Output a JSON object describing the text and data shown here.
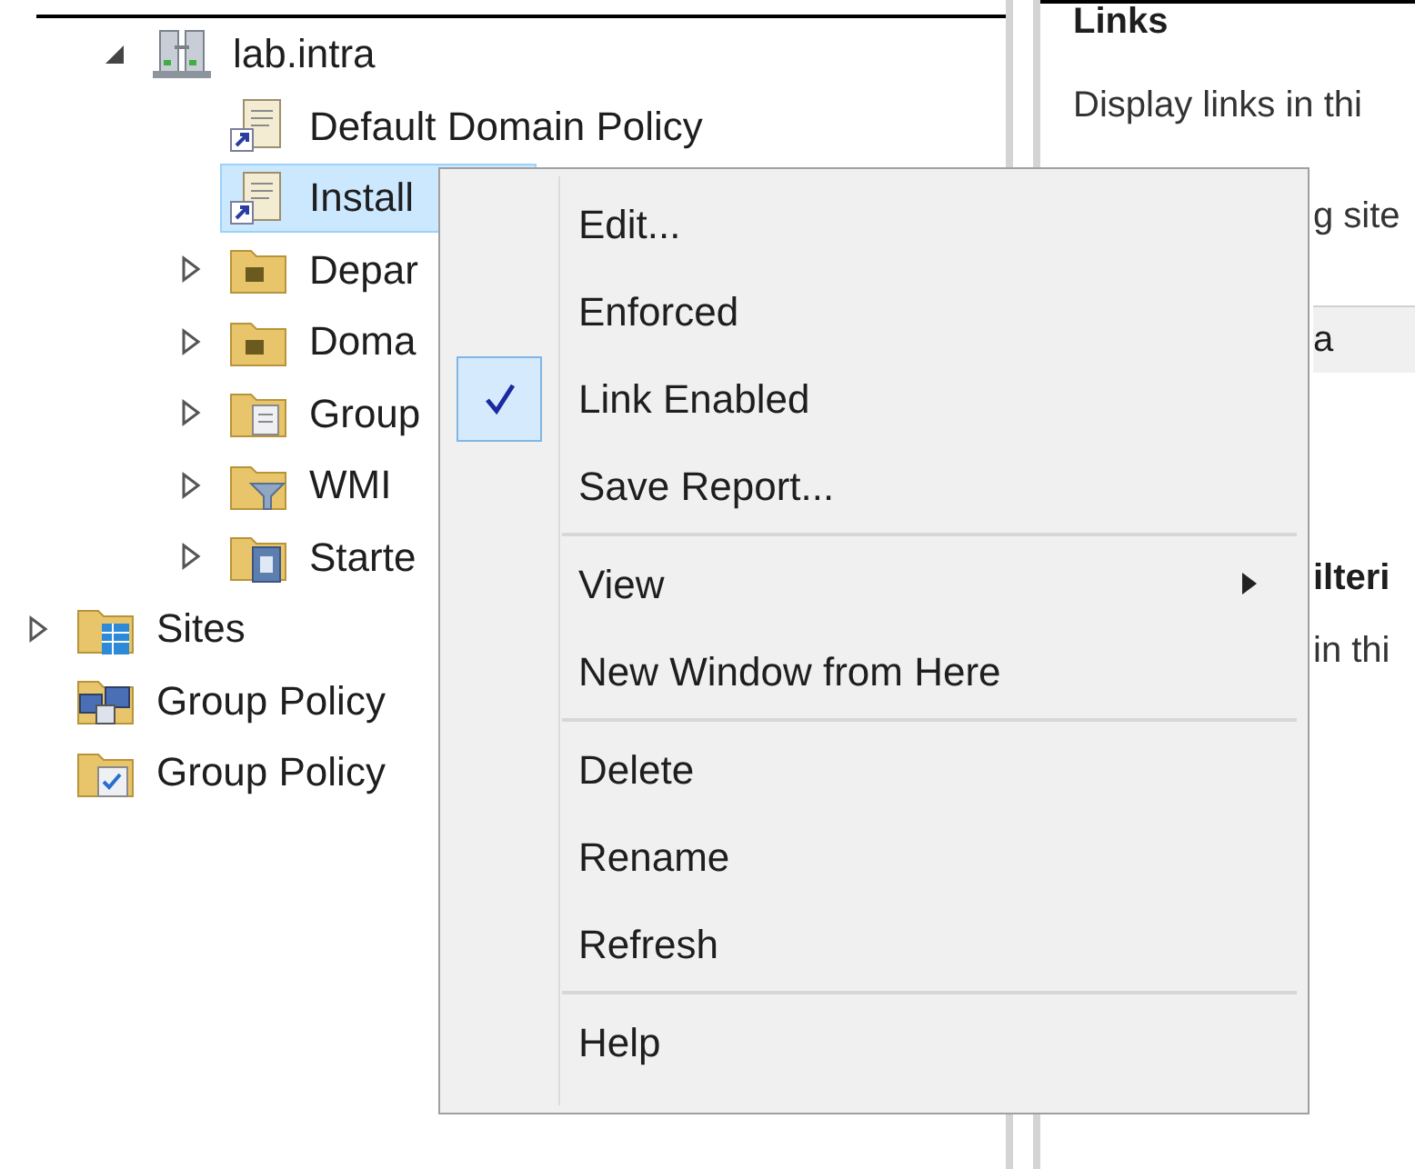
{
  "tree": {
    "partial_branch": [
      {
        "label": "lab.intra",
        "kind": "domain",
        "expanded": true,
        "selected": false,
        "children": [
          {
            "label": "Default Domain Policy",
            "kind": "gpo-link",
            "selected": false
          },
          {
            "label": "Install",
            "kind": "gpo-link",
            "selected": true
          },
          {
            "label": "Depar",
            "kind": "ou-folder",
            "expanded": false,
            "selected": false
          },
          {
            "label": "Doma",
            "kind": "ou-folder",
            "expanded": false,
            "selected": false
          },
          {
            "label": "Group",
            "kind": "policy-folder",
            "expanded": false,
            "selected": false
          },
          {
            "label": "WMI",
            "kind": "filter-folder",
            "expanded": false,
            "selected": false
          },
          {
            "label": "Starte",
            "kind": "starter-folder",
            "expanded": false,
            "selected": false
          }
        ]
      }
    ],
    "items": [
      {
        "label": "Sites",
        "kind": "sites-folder",
        "expanded": false,
        "selected": false
      },
      {
        "label": "Group Policy",
        "kind": "modeling",
        "selected": false
      },
      {
        "label": "Group Policy",
        "kind": "results",
        "selected": false
      }
    ]
  },
  "details": {
    "heading": "Links",
    "description": "Display links in thi",
    "fragments": [
      {
        "text": "g site",
        "kind": "plain"
      },
      {
        "text": "a",
        "kind": "header-row"
      },
      {
        "text": "ilteri",
        "kind": "heading"
      },
      {
        "text": "in thi",
        "kind": "plain"
      }
    ]
  },
  "context_menu": [
    {
      "kind": "item",
      "label": "Edit...",
      "checked": false,
      "has_submenu": false
    },
    {
      "kind": "item",
      "label": "Enforced",
      "checked": false,
      "has_submenu": false
    },
    {
      "kind": "item",
      "label": "Link Enabled",
      "checked": true,
      "has_submenu": false
    },
    {
      "kind": "item",
      "label": "Save Report...",
      "checked": false,
      "has_submenu": false
    },
    {
      "kind": "separator"
    },
    {
      "kind": "item",
      "label": "View",
      "checked": false,
      "has_submenu": true
    },
    {
      "kind": "item",
      "label": "New Window from Here",
      "checked": false,
      "has_submenu": false
    },
    {
      "kind": "separator"
    },
    {
      "kind": "item",
      "label": "Delete",
      "checked": false,
      "has_submenu": false
    },
    {
      "kind": "item",
      "label": "Rename",
      "checked": false,
      "has_submenu": false
    },
    {
      "kind": "item",
      "label": "Refresh",
      "checked": false,
      "has_submenu": false
    },
    {
      "kind": "separator"
    },
    {
      "kind": "item",
      "label": "Help",
      "checked": false,
      "has_submenu": false
    }
  ]
}
